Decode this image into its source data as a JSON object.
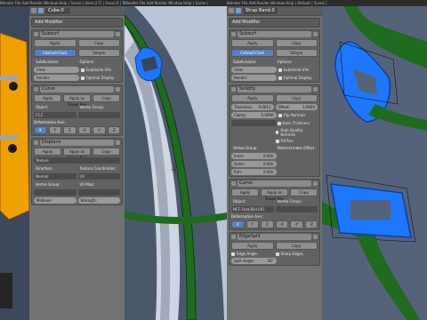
{
  "topbars": {
    "a": "Blender File Add Render Window Help | Scene | Verts:271 | Faces:0 | Tris:0 | ",
    "b": "Blender File Add Render Window Help | Scene | ",
    "c": "Blender File Add Render Window Help | Default | Scene | "
  },
  "panel_left": {
    "object_name": "Cube.0",
    "add_modifier": "Add Modifier",
    "mod1": {
      "name": "Subsurf",
      "apply": "Apply",
      "copy": "Copy",
      "tab1": "Catmull-Clark",
      "tab2": "Simple",
      "subdiv_label": "Subdivisions:",
      "options_label": "Options:",
      "view": "View:",
      "render": "Render:",
      "opt1": "Subdivide UVs",
      "opt2": "Optimal Display"
    },
    "mod2": {
      "name": "Curve",
      "apply": "Apply",
      "apply_shape": "Apply as Shape Key",
      "copy": "Copy",
      "obj_label": "Object:",
      "vg_label": "Vertex Group:",
      "obj_value": "CC2",
      "axis_label": "Deformation Axis:",
      "axes": [
        "X",
        "Y",
        "Z",
        "-X",
        "-Y",
        "-Z"
      ]
    },
    "mod3": {
      "name": "Displace",
      "apply": "Apply",
      "apply_shape": "Apply as Shape Key",
      "copy": "Copy",
      "texture_label": "Texture",
      "dir_label": "Direction:",
      "coord_label": "Texture Coordinates:",
      "dir_value": "Normal",
      "coord_value": "UV",
      "vg_label": "Vertex Group:",
      "uvmap_label": "UV Map:",
      "midlevel": "Midlevel:",
      "strength": "Strength:"
    }
  },
  "panel_right": {
    "object_name": "Strap Band.0",
    "add_modifier": "Add Modifier",
    "mod1": {
      "name": "Subsurf",
      "apply": "Apply",
      "copy": "Copy",
      "tab1": "Catmull-Clark",
      "tab2": "Simple",
      "subdiv_label": "Subdivisions:",
      "options_label": "Options:",
      "view": "View:",
      "render": "Render:",
      "opt1": "Subdivide UVs",
      "opt2": "Optimal Display"
    },
    "mod2": {
      "name": "Solidify",
      "apply": "Apply",
      "copy": "Copy",
      "thickness": "Thickness:",
      "thickness_val": "0.0011",
      "offset": "Offset:",
      "offset_val": "1.0000",
      "clamp": "Clamp:",
      "clamp_val": "0.0000",
      "opt1": "Flip Normals",
      "opt2": "Even Thickness",
      "opt3": "High Quality Normals",
      "opt4": "Fill Rim",
      "vg_label": "Vertex Group:",
      "mat_label": "Material Index Offset:",
      "inner": "Inner:",
      "inner_val": "0.000",
      "outer": "Outer:",
      "outer_val": "0.000",
      "rim": "Rim:",
      "rim_val": "0.000"
    },
    "mod3": {
      "name": "Curve",
      "apply": "Apply",
      "apply_shape": "Apply as Shape Key",
      "copy": "Copy",
      "obj_label": "Object:",
      "vg_label": "Vertex Group:",
      "obj_value": "NCC.Fold.Bild.001",
      "axis_label": "Deformation Axis:",
      "axes": [
        "X",
        "Y",
        "Z",
        "-X",
        "-Y",
        "-Z"
      ]
    },
    "mod4": {
      "name": "EdgeSplit",
      "apply": "Apply",
      "copy": "Copy",
      "opt1": "Edge Angle:",
      "opt2": "Sharp Edges",
      "split_label": "Split Angle:",
      "split_val": "30°"
    }
  },
  "colors": {
    "accent": "#5680c2",
    "band_green": "#1e6b1e",
    "buckle_blue": "#1e78ff",
    "part_orange": "#f0a000"
  }
}
